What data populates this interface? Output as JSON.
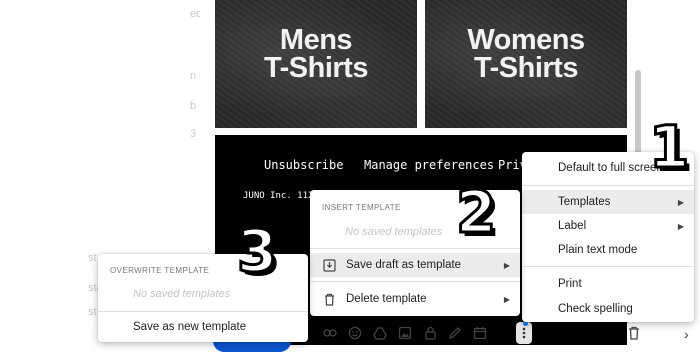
{
  "tiles": [
    {
      "line1": "Mens",
      "line2": "T-Shirts"
    },
    {
      "line1": "Womens",
      "line2": "T-Shirts"
    }
  ],
  "footer": {
    "links": [
      "Unsubscribe",
      "Manage preferences",
      "Priv"
    ],
    "address": "JUNO Inc. 112"
  },
  "more_options_menu": {
    "items": [
      {
        "label": "Default to full screen"
      },
      {
        "label": "Templates"
      },
      {
        "label": "Label"
      },
      {
        "label": "Plain text mode"
      },
      {
        "label": "Print"
      },
      {
        "label": "Check spelling"
      }
    ]
  },
  "templates_menu": {
    "section_title": "INSERT TEMPLATE",
    "empty_text": "No saved templates",
    "save_draft_label": "Save draft as template",
    "delete_label": "Delete template"
  },
  "overwrite_menu": {
    "section_title": "OVERWRITE TEMPLATE",
    "empty_text": "No saved templates",
    "save_new_label": "Save as new template"
  },
  "annotations": [
    "1",
    "2",
    "3"
  ],
  "toolbar_icons": [
    "attach-icon",
    "link-icon",
    "emoji-icon",
    "drive-icon",
    "photo-icon",
    "lock-icon",
    "pen-icon",
    "schedule-icon",
    "more-options-icon",
    "trash-icon"
  ],
  "colors": {
    "send_button": "#0b57d0",
    "highlight": "#ececec",
    "accent_dot": "#1a73e8"
  }
}
